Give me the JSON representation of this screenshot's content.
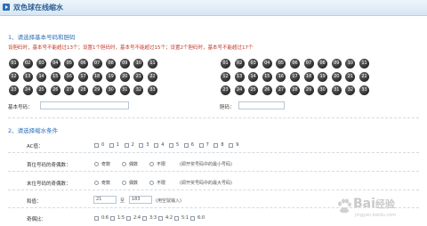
{
  "title": "双色球在线缩水",
  "section1": {
    "heading": "1、请选择基本号码和胆码",
    "rule": "设胆码时，基本号不能超过13个；设置1个胆码时，基本号不能超过15个；设置2个胆码时，基本号不能超过17个",
    "basic_label": "基本号码：",
    "dan_label": "胆码：",
    "basic_balls": [
      "01",
      "02",
      "03",
      "04",
      "05",
      "06",
      "07",
      "08",
      "09",
      "10",
      "11",
      "12",
      "13",
      "14",
      "15",
      "16",
      "17",
      "18",
      "19",
      "20",
      "21",
      "22",
      "23",
      "24",
      "25",
      "26",
      "27",
      "28",
      "29",
      "30",
      "31",
      "32",
      "33"
    ],
    "dan_balls": [
      "01",
      "02",
      "03",
      "04",
      "05",
      "06",
      "07",
      "08",
      "09",
      "10",
      "11",
      "12",
      "13",
      "14",
      "15",
      "16",
      "17",
      "18",
      "19",
      "20",
      "21",
      "22",
      "23",
      "24",
      "25",
      "26",
      "27",
      "28",
      "29",
      "30",
      "31",
      "32",
      "33"
    ]
  },
  "section2": {
    "heading": "2、请选择缩水条件",
    "ac_label": "AC值：",
    "ac_options": [
      "0",
      "1",
      "2",
      "3",
      "4",
      "5",
      "6",
      "7",
      "8",
      "9"
    ],
    "first_label": "首位号码的奇偶数：",
    "first_options": [
      "奇数",
      "偶数",
      "不限"
    ],
    "first_note": "(即开奖号码中的最小号码)",
    "last_label": "末位号码的奇偶数：",
    "last_options": [
      "奇数",
      "偶数",
      "不限"
    ],
    "last_note": "(即开奖号码中的最大号码)",
    "sum_label": "和值：",
    "sum_from": "21",
    "sum_to_word": "至",
    "sum_to": "183",
    "sum_note": "(用空鼠输入)",
    "odd_label": "奇偶比：",
    "odd_options": [
      "0:6",
      "1:5",
      "2:4",
      "3:3",
      "4:2",
      "5:1",
      "6:0"
    ]
  },
  "watermark": {
    "brand": "Bai",
    "brand2": "经验",
    "url": "jingyan.baidu.com"
  }
}
